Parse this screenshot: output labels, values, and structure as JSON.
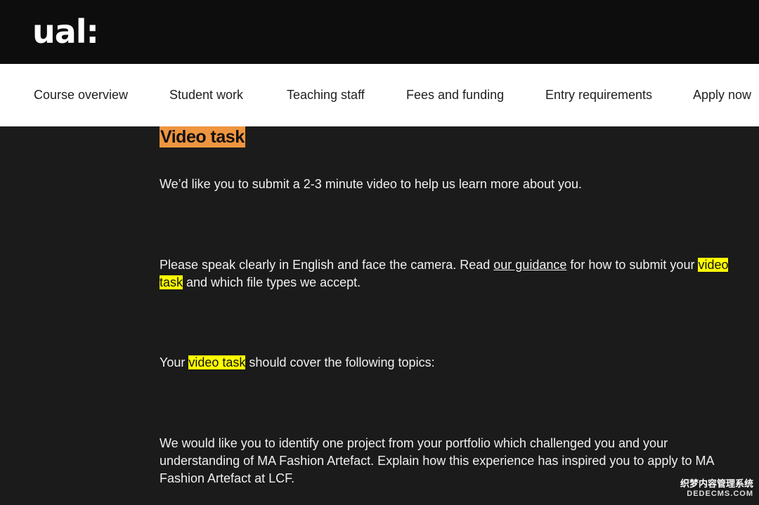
{
  "header": {
    "logo_text": "ual:"
  },
  "nav": {
    "items": [
      {
        "label": "Course overview"
      },
      {
        "label": "Student work"
      },
      {
        "label": "Teaching staff"
      },
      {
        "label": "Fees and funding"
      },
      {
        "label": "Entry requirements"
      },
      {
        "label": "Apply now"
      }
    ]
  },
  "content": {
    "title": "Video task",
    "p1": "We’d like you to submit a 2-3 minute video to help us learn more about you.",
    "p2": {
      "before_link": "Please speak clearly in English and face the camera. Read ",
      "link": "our guidance",
      "after_link": " for how to submit your ",
      "highlight_a": "video",
      "space": " ",
      "highlight_b": "task",
      "after_highlight": " and which file types we accept."
    },
    "p3": {
      "before": "Your ",
      "highlight": "video task",
      "after": " should cover the following topics:"
    },
    "p4": "We would like you to identify one project from your portfolio which challenged you and your understanding of MA Fashion Artefact. Explain how this experience has inspired you to apply to MA Fashion Artefact at LCF."
  },
  "watermark": {
    "line1": "织梦内容管理系统",
    "line2": "DEDECMS.COM"
  },
  "colors": {
    "title_bg": "#ef9540",
    "highlight": "#ffff00",
    "page_bg": "#1b1b1b",
    "topbar_bg": "#0d0d0d"
  }
}
